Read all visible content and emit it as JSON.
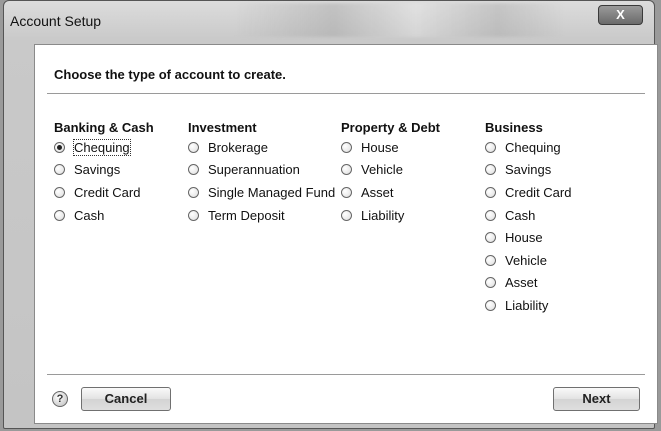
{
  "window": {
    "title": "Account Setup",
    "close_label": "X"
  },
  "heading": "Choose the type of account to create.",
  "columns": [
    {
      "title": "Banking & Cash",
      "options": [
        "Chequing",
        "Savings",
        "Credit Card",
        "Cash"
      ],
      "selected": 0
    },
    {
      "title": "Investment",
      "options": [
        "Brokerage",
        "Superannuation",
        "Single Managed Fund",
        "Term Deposit"
      ]
    },
    {
      "title": "Property & Debt",
      "options": [
        "House",
        "Vehicle",
        "Asset",
        "Liability"
      ]
    },
    {
      "title": "Business",
      "options": [
        "Chequing",
        "Savings",
        "Credit Card",
        "Cash",
        "House",
        "Vehicle",
        "Asset",
        "Liability"
      ]
    }
  ],
  "footer": {
    "help_label": "?",
    "cancel_label": "Cancel",
    "next_label": "Next"
  }
}
